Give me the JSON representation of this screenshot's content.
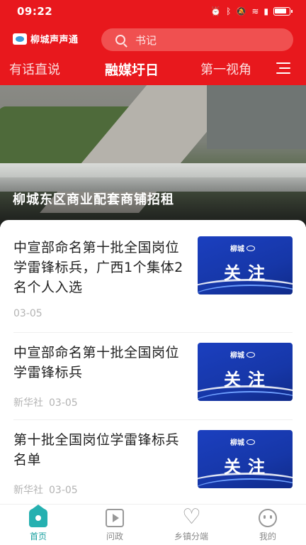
{
  "status_bar": {
    "time": "09:22",
    "icons": [
      "alarm-icon",
      "bluetooth-icon",
      "mute-icon",
      "wifi-icon",
      "signal-icon",
      "battery-icon"
    ]
  },
  "header": {
    "logo_text": "柳城声声通",
    "search_placeholder": "书记",
    "tabs": [
      {
        "label": "有话直说",
        "active": false
      },
      {
        "label": "融媒圩日",
        "active": true
      },
      {
        "label": "第一视角",
        "active": false
      }
    ]
  },
  "hero": {
    "caption": "柳城东区商业配套商铺招租"
  },
  "news": [
    {
      "title": "中宣部命名第十批全国岗位学雷锋标兵，广西1个集体2名个人入选",
      "source": "",
      "date": "03-05",
      "thumb_text": "关注",
      "thumb_logo": "柳城"
    },
    {
      "title": "中宣部命名第十批全国岗位学雷锋标兵",
      "source": "新华社",
      "date": "03-05",
      "thumb_text": "关注",
      "thumb_logo": "柳城"
    },
    {
      "title": "第十批全国岗位学雷锋标兵名单",
      "source": "新华社",
      "date": "03-05",
      "thumb_text": "关注",
      "thumb_logo": "柳城"
    }
  ],
  "bottom_nav": [
    {
      "label": "首页",
      "icon": "home-icon",
      "active": true
    },
    {
      "label": "问政",
      "icon": "video-icon",
      "active": false
    },
    {
      "label": "乡镇分端",
      "icon": "heart-icon",
      "active": false
    },
    {
      "label": "我的",
      "icon": "face-icon",
      "active": false
    }
  ],
  "colors": {
    "brand_red": "#e8181d",
    "accent_teal": "#1aa0a0",
    "thumb_blue": "#1637a8"
  }
}
